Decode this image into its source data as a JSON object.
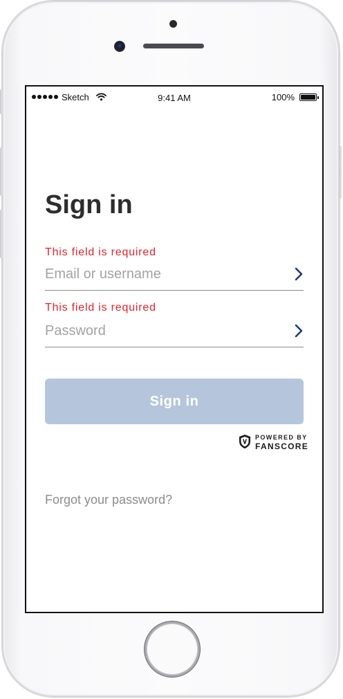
{
  "status_bar": {
    "carrier": "Sketch",
    "time": "9:41 AM",
    "battery": "100%",
    "signal_icon": "signal-dots-icon",
    "wifi_icon": "wifi-icon",
    "battery_icon": "battery-icon",
    "battery_level": 1.0
  },
  "screen": {
    "title": "Sign in",
    "email": {
      "error": "This field is required",
      "placeholder": "Email or username",
      "value": "",
      "action_icon": "chevron-right-icon"
    },
    "password": {
      "error": "This field is required",
      "placeholder": "Password",
      "value": "",
      "action_icon": "chevron-right-icon"
    },
    "submit_label": "Sign in",
    "powered_by": {
      "prefix": "POWERED BY",
      "brand": "FANSCORE",
      "logo_icon": "fanscore-shield-icon"
    },
    "forgot_link": "Forgot your password?"
  },
  "colors": {
    "error": "#e8202a",
    "accent": "#1f3a78",
    "button_disabled": "#b5c6dc",
    "title": "#2d2d2d",
    "muted": "#8c8c8c"
  }
}
